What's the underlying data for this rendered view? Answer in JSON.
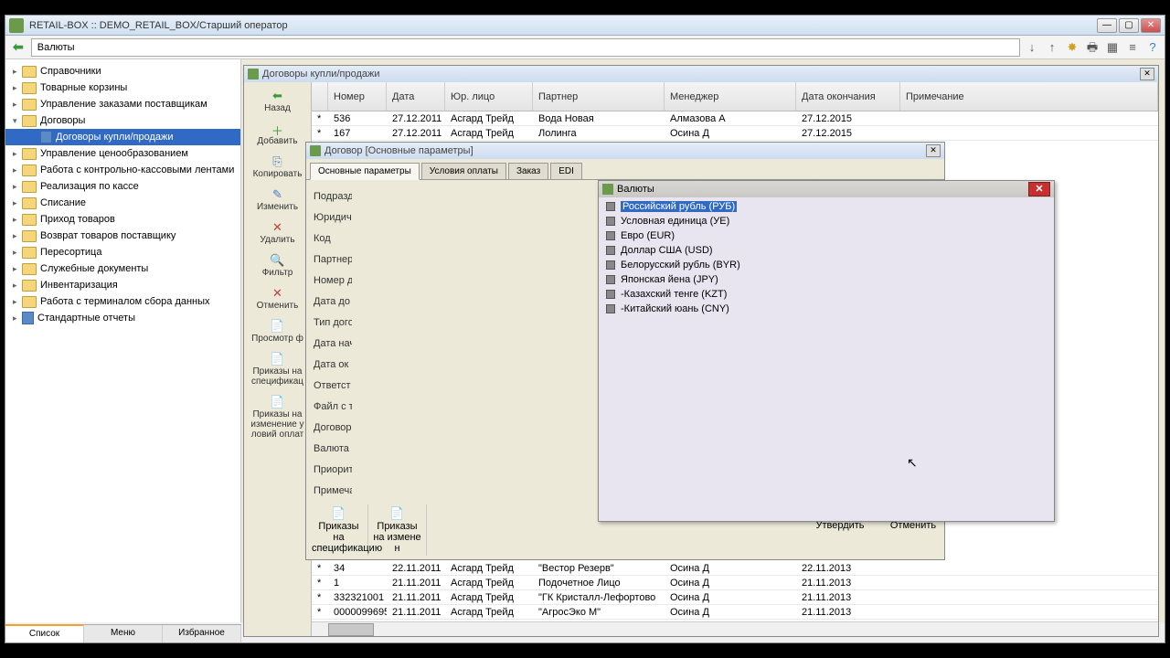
{
  "window": {
    "title": "RETAIL-BOX :: DEMO_RETAIL_BOX/Старший оператор"
  },
  "toolbar": {
    "address": "Валюты"
  },
  "tree": {
    "items": [
      {
        "label": "Справочники",
        "type": "folder"
      },
      {
        "label": "Товарные корзины",
        "type": "folder"
      },
      {
        "label": "Управление заказами поставщикам",
        "type": "folder"
      },
      {
        "label": "Договоры",
        "type": "folder",
        "expanded": true
      },
      {
        "label": "Договоры купли/продажи",
        "type": "doc",
        "child": true,
        "selected": true
      },
      {
        "label": "Управление ценообразованием",
        "type": "folder"
      },
      {
        "label": "Работа с контрольно-кассовыми лентами",
        "type": "folder"
      },
      {
        "label": "Реализация по кассе",
        "type": "folder"
      },
      {
        "label": "Списание",
        "type": "folder"
      },
      {
        "label": "Приход товаров",
        "type": "folder"
      },
      {
        "label": "Возврат товаров поставщику",
        "type": "folder"
      },
      {
        "label": "Пересортица",
        "type": "folder"
      },
      {
        "label": "Служебные документы",
        "type": "folder"
      },
      {
        "label": "Инвентаризация",
        "type": "folder"
      },
      {
        "label": "Работа с терминалом сбора данных",
        "type": "folder"
      },
      {
        "label": "Стандартные отчеты",
        "type": "doc"
      }
    ]
  },
  "footer": {
    "tabs": [
      "Список",
      "Меню",
      "Избранное"
    ]
  },
  "contracts": {
    "title": "Договоры купли/продажи",
    "toolbar": [
      "Назад",
      "Добавить",
      "Копировать",
      "Изменить",
      "Удалить",
      "Фильтр",
      "Отменить",
      "Просмотр ф",
      "Приказы на спецификац",
      "Приказы на изменение у ловий оплат"
    ],
    "columns": [
      "",
      "Номер",
      "Дата",
      "Юр. лицо",
      "Партнер",
      "Менеджер",
      "Дата окончания",
      "Примечание"
    ],
    "rows_top": [
      {
        "s": "*",
        "num": "536",
        "date": "27.12.2011",
        "legal": "Асгард Трейд",
        "partner": "Вода Новая",
        "mgr": "Алмазова А",
        "end": "27.12.2015"
      },
      {
        "s": "*",
        "num": "167",
        "date": "27.12.2011",
        "legal": "Асгард Трейд",
        "partner": "Лолинга",
        "mgr": "Осина Д",
        "end": "27.12.2015"
      }
    ],
    "rows_bottom": [
      {
        "s": "*",
        "num": "34",
        "date": "22.11.2011",
        "legal": "Асгард Трейд",
        "partner": "\"Вестор Резерв\"",
        "mgr": "Осина Д",
        "end": "22.11.2013"
      },
      {
        "s": "*",
        "num": "1",
        "date": "21.11.2011",
        "legal": "Асгард Трейд",
        "partner": "Подочетное Лицо",
        "mgr": "Осина Д",
        "end": "21.11.2013"
      },
      {
        "s": "*",
        "num": "332321001",
        "date": "21.11.2011",
        "legal": "Асгард Трейд",
        "partner": "\"ГК Кристалл-Лефортово",
        "mgr": "Осина Д",
        "end": "21.11.2013"
      },
      {
        "s": "*",
        "num": "0000099695",
        "date": "21.11.2011",
        "legal": "Асгард Трейд",
        "partner": "\"АгросЭко М\"",
        "mgr": "Осина Д",
        "end": "21.11.2013"
      }
    ]
  },
  "contract_form": {
    "title": "Договор [Основные параметры]",
    "tabs": [
      "Основные параметры",
      "Условия оплаты",
      "Заказ",
      "EDI"
    ],
    "labels": [
      "Подразд",
      "Юридич",
      "Код",
      "Партнер",
      "Номер д",
      "Дата до",
      "Тип дого",
      "Дата нач",
      "Дата ок",
      "Ответст",
      "Файл с т",
      "Договор",
      "Валюта",
      "Приорит",
      "Примеча"
    ],
    "bottom_left": [
      {
        "label": "Приказы на спецификацию"
      },
      {
        "label": "Приказы на измене н"
      }
    ],
    "confirm": "Утвердить",
    "cancel": "Отменить"
  },
  "currency": {
    "title": "Валюты",
    "items": [
      {
        "label": "Российский рубль (РУБ)",
        "selected": true
      },
      {
        "label": "Условная единица (УЕ)"
      },
      {
        "label": "Евро (EUR)"
      },
      {
        "label": "Доллар США (USD)"
      },
      {
        "label": "Белорусский рубль (BYR)"
      },
      {
        "label": "Японская йена (JPY)"
      },
      {
        "label": "-Казахский тенге (KZT)"
      },
      {
        "label": "-Китайский юань (CNY)"
      }
    ]
  }
}
